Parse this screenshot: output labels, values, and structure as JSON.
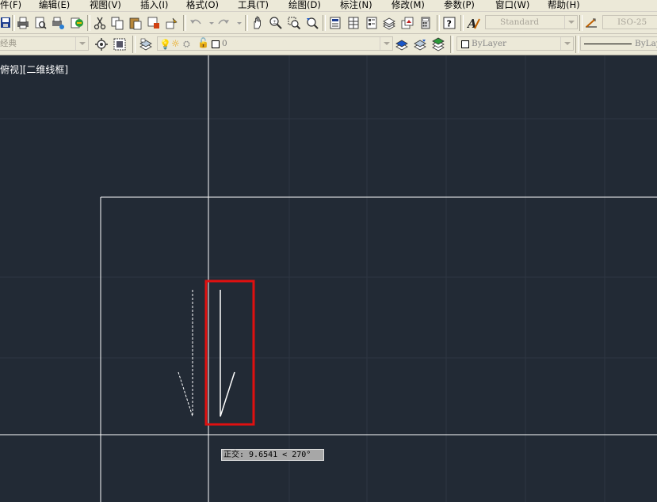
{
  "menubar": {
    "items": [
      "件(F)",
      "编辑(E)",
      "视图(V)",
      "插入(I)",
      "格式(O)",
      "工具(T)",
      "绘图(D)",
      "标注(N)",
      "修改(M)",
      "参数(P)",
      "窗口(W)",
      "帮助(H)"
    ]
  },
  "toolbar1": {
    "text_style": "Standard",
    "dim_style": "ISO-25"
  },
  "toolbar2": {
    "workspace": "经典",
    "layer": "0",
    "color": "ByLayer",
    "linetype": "ByLay"
  },
  "drawing": {
    "viewport_label": "俯视][二维线框]",
    "tooltip": "正交: 9.6541 < 270°",
    "colors": {
      "background": "#222a35",
      "grid": "#2e3642",
      "line": "#ffffff",
      "highlight": "#e01010"
    }
  }
}
